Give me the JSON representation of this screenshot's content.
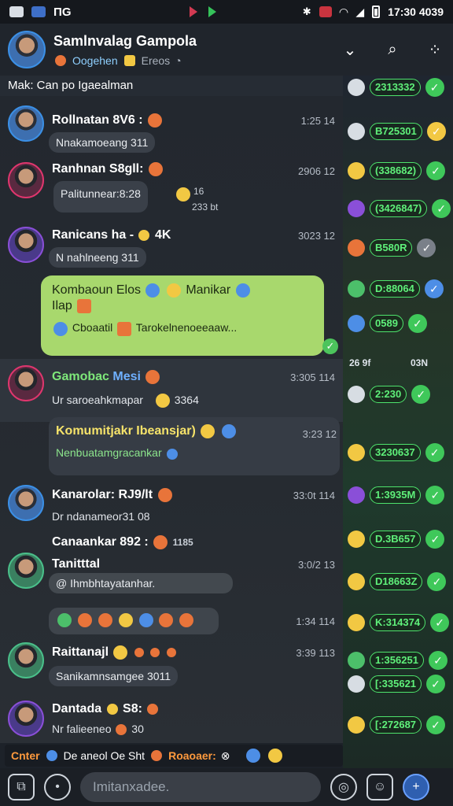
{
  "status_bar": {
    "left_text": "ΠG",
    "time": "17:30 4039"
  },
  "header": {
    "title": "Samlnvalag Gampola",
    "subtitle": "Oogehen",
    "subtitle_extra": "Ereos"
  },
  "pinned": {
    "text": "Mak:  Can po Igaealman"
  },
  "messages": [
    {
      "sender": "Rollnatan 8V6 :",
      "time": "1:25 14",
      "text": "Nnakamoeang 311"
    },
    {
      "sender": "Ranhnan S8gll:",
      "time": "2906 12",
      "text": "Palitunnear:8:28",
      "meta": "16",
      "meta2": "233 bt"
    },
    {
      "sender": "Ranicans ha -",
      "badge": "4K",
      "time": "3023 12",
      "text": "N nahlneeng 311"
    },
    {
      "line1": "Kombaoun Elos",
      "line1b": "Manikar",
      "line2": "Ilap",
      "line3": "Cboaatil",
      "line3b": "Tarokelnenoeeaaw..."
    },
    {
      "sender": "Gamobac",
      "tag": "Mesi",
      "time": "3:305 114",
      "text": "Ur saroeahkmapar",
      "meta": "3364"
    },
    {
      "title": "Komumitjakr Ibeansjar)",
      "time": "3:23 12",
      "text": "Nenbuatamgracankar"
    },
    {
      "sender": "Kanarolar: RJ9/lt",
      "time": "33:0t 114",
      "text": "Dr ndanameor31 08"
    },
    {
      "sender": "Canaankar 892 :",
      "badge": "1185",
      "time": "3:0/2 13",
      "sender2": "Tanitttal",
      "text": "@ Ihmbhtayatanhar."
    },
    {
      "time": "1:34 114"
    },
    {
      "sender": "Raittanajl",
      "time": "3:39 113",
      "text": "Sanikamnsamgee 3011"
    },
    {
      "sender": "Dantada",
      "badge": "S8:",
      "time": "",
      "text": "Nr falieeneo",
      "meta": "30"
    }
  ],
  "right_column": {
    "rows": [
      "2313332",
      "B725301",
      "(338682)",
      "(3426847)",
      "B580R",
      "D:88064",
      "0589",
      "2:230",
      "3230637",
      "1:3935M",
      "D.3B657",
      "D18663Z",
      "K:314374",
      "1:356251",
      "[:335621",
      "[:272687"
    ],
    "label1": "26 9f",
    "label2": "03N"
  },
  "notice": {
    "left": "Cnter",
    "middle": "De aneol Oe Sht",
    "right": "Roaoaer:"
  },
  "composer": {
    "placeholder": "Imitanxadee."
  }
}
